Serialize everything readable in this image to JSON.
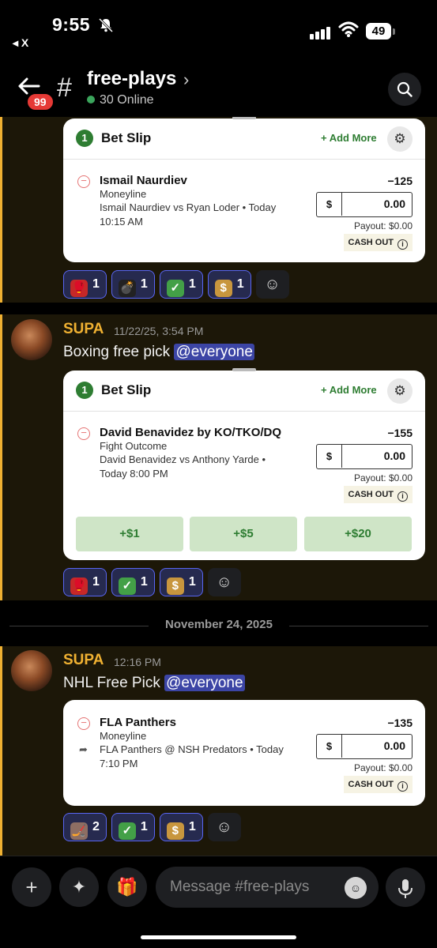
{
  "status": {
    "time": "9:55",
    "back_app": "◂ X",
    "battery": "49"
  },
  "header": {
    "channel": "free-plays",
    "online": "30 Online",
    "unread_badge": "99"
  },
  "cards": [
    {
      "count": "1",
      "title": "Bet Slip",
      "add_more": "+ Add More",
      "leg": {
        "selection": "Ismail Naurdiev",
        "market": "Moneyline",
        "matchup": "Ismail Naurdiev vs Ryan Loder • Today",
        "time": "10:15 AM",
        "odds": "−125",
        "currency": "$",
        "stake": "0.00",
        "payout": "Payout: $0.00",
        "cashout": "CASH OUT"
      }
    },
    {
      "count": "1",
      "title": "Bet Slip",
      "add_more": "+ Add More",
      "leg": {
        "selection": "David Benavidez by KO/TKO/DQ",
        "market": "Fight Outcome",
        "matchup": "David Benavidez vs Anthony Yarde •",
        "time": "Today 8:00 PM",
        "odds": "−155",
        "currency": "$",
        "stake": "0.00",
        "payout": "Payout: $0.00",
        "cashout": "CASH OUT"
      },
      "quick": [
        "+$1",
        "+$5",
        "+$20"
      ]
    },
    {
      "leg": {
        "selection": "FLA Panthers",
        "market": "Moneyline",
        "matchup": "FLA Panthers @ NSH Predators • Today",
        "time": "7:10 PM",
        "odds": "−135",
        "currency": "$",
        "stake": "0.00",
        "payout": "Payout: $0.00",
        "cashout": "CASH OUT"
      }
    }
  ],
  "reactions": [
    [
      {
        "icon": "boxing-glove",
        "count": "1"
      },
      {
        "icon": "bomb",
        "count": "1"
      },
      {
        "icon": "check",
        "count": "1"
      },
      {
        "icon": "money-bag",
        "count": "1"
      }
    ],
    [
      {
        "icon": "boxing-glove",
        "count": "1"
      },
      {
        "icon": "check",
        "count": "1"
      },
      {
        "icon": "money-bag",
        "count": "1"
      }
    ],
    [
      {
        "icon": "hockey-stick",
        "count": "2"
      },
      {
        "icon": "check",
        "count": "1"
      },
      {
        "icon": "money-bag",
        "count": "1"
      }
    ]
  ],
  "messages": [
    {
      "author": "SUPA",
      "timestamp": "11/22/25, 3:54 PM",
      "text": "Boxing free pick ",
      "mention": "@everyone"
    },
    {
      "author": "SUPA",
      "timestamp": "12:16 PM",
      "text": "NHL Free Pick ",
      "mention": "@everyone"
    }
  ],
  "date_divider": "November 24, 2025",
  "composer": {
    "placeholder": "Message #free-plays"
  }
}
